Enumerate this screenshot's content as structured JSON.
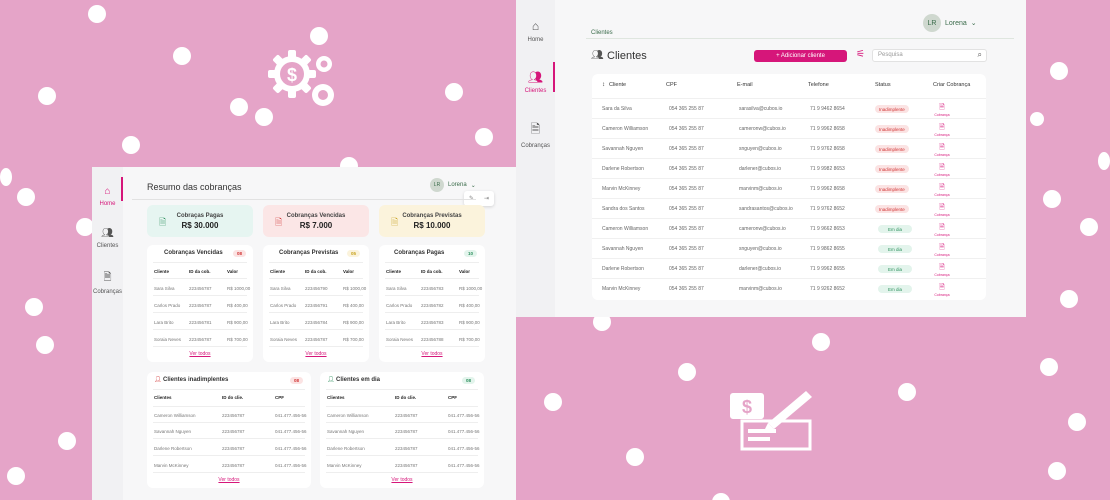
{
  "colors": {
    "accent": "#d6167a",
    "background": "#e5a4c8"
  },
  "dashboard": {
    "nav": [
      {
        "label": "Home",
        "icon": "home-icon",
        "active": true
      },
      {
        "label": "Clientes",
        "icon": "users-icon",
        "active": false
      },
      {
        "label": "Cobranças",
        "icon": "document-icon",
        "active": false
      }
    ],
    "title": "Resumo das cobranças",
    "user": {
      "initials": "LR",
      "name": "Lorena"
    },
    "kpis": [
      {
        "title": "Cobraças Pagas",
        "value": "R$ 30.000"
      },
      {
        "title": "Cobranças Vencidas",
        "value": "R$ 7.000"
      },
      {
        "title": "Cobranças Previstas",
        "value": "R$ 10.000"
      }
    ],
    "tables": [
      {
        "title": "Cobranças Vencidas",
        "count": "08",
        "headers": [
          "Cliente",
          "ID da cob.",
          "Valor"
        ],
        "rows": [
          [
            "Sara Silva",
            "223456787",
            "R$ 1000,00"
          ],
          [
            "Carlos Prado",
            "223456787",
            "R$ 400,00"
          ],
          [
            "Lara Brito",
            "223456781",
            "R$ 900,00"
          ],
          [
            "Soraia Neves",
            "223456787",
            "R$ 700,00"
          ]
        ],
        "link": "Ver todos"
      },
      {
        "title": "Cobranças Previstas",
        "count": "05",
        "headers": [
          "Cliente",
          "ID da cob.",
          "Valor"
        ],
        "rows": [
          [
            "Sara Silva",
            "223456790",
            "R$ 1000,00"
          ],
          [
            "Carlos Prado",
            "223456791",
            "R$ 400,00"
          ],
          [
            "Lara Brito",
            "223456784",
            "R$ 900,00"
          ],
          [
            "Soraia Neves",
            "223456787",
            "R$ 700,00"
          ]
        ],
        "link": "Ver todos"
      },
      {
        "title": "Cobranças Pagas",
        "count": "10",
        "headers": [
          "Cliente",
          "ID da cob.",
          "Valor"
        ],
        "rows": [
          [
            "Sara Silva",
            "223456783",
            "R$ 1000,00"
          ],
          [
            "Carlos Prado",
            "223456782",
            "R$ 400,00"
          ],
          [
            "Lara Brito",
            "223456783",
            "R$ 900,00"
          ],
          [
            "Soraia Neves",
            "223456788",
            "R$ 700,00"
          ]
        ],
        "link": "Ver todos"
      }
    ],
    "client_tables": [
      {
        "title": "Clientes inadimplentes",
        "count": "08",
        "headers": [
          "Clientes",
          "ID do clie.",
          "CPF"
        ],
        "rows": [
          [
            "Cameron Williamson",
            "223456787",
            "041.477.456-56"
          ],
          [
            "Savannah Nguyen",
            "223456787",
            "041.477.456-56"
          ],
          [
            "Darlene Robertson",
            "223456787",
            "041.477.456-56"
          ],
          [
            "Marvin McKinney",
            "223456787",
            "041.477.456-56"
          ]
        ],
        "link": "Ver todos"
      },
      {
        "title": "Clientes em dia",
        "count": "08",
        "headers": [
          "Clientes",
          "ID do clie.",
          "CPF"
        ],
        "rows": [
          [
            "Cameron Williamson",
            "223456787",
            "041.477.456-56"
          ],
          [
            "Savannah Nguyen",
            "223456787",
            "041.477.456-56"
          ],
          [
            "Darlene Robertson",
            "223456787",
            "041.477.456-56"
          ],
          [
            "Marvin McKinney",
            "223456787",
            "041.477.456-56"
          ]
        ],
        "link": "Ver todos"
      }
    ]
  },
  "clients": {
    "nav": [
      {
        "label": "Home",
        "icon": "home-icon",
        "active": false
      },
      {
        "label": "Clientes",
        "icon": "users-icon",
        "active": true
      },
      {
        "label": "Cobranças",
        "icon": "document-icon",
        "active": false
      }
    ],
    "breadcrumb": "Clientes",
    "user": {
      "initials": "LR",
      "name": "Lorena"
    },
    "title": "Clientes",
    "add_button": "+ Adicionar cliente",
    "search_placeholder": "Pesquisa",
    "headers": [
      "Cliente",
      "CPF",
      "E-mail",
      "Telefone",
      "Status",
      "Criar Cobrança"
    ],
    "action_label": "Cobrança",
    "rows": [
      {
        "name": "Sara da Silva",
        "cpf": "054 365 255 87",
        "email": "sarasilva@cubos.io",
        "phone": "71 9 9462 8654",
        "status": "Inadimplente",
        "ok": false
      },
      {
        "name": "Cameron Williamson",
        "cpf": "054 365 255 87",
        "email": "cameronw@cubos.io",
        "phone": "71 9 9962 8658",
        "status": "Inadimplente",
        "ok": false
      },
      {
        "name": "Savannah Nguyen",
        "cpf": "054 365 255 87",
        "email": "snguyen@cubos.io",
        "phone": "71 9 9762 8658",
        "status": "Inadimplente",
        "ok": false
      },
      {
        "name": "Darlene Robertson",
        "cpf": "054 365 255 87",
        "email": "darlener@cubos.io",
        "phone": "71 9 9982 8653",
        "status": "Inadimplente",
        "ok": false
      },
      {
        "name": "Marvin McKinney",
        "cpf": "054 365 255 87",
        "email": "marvinm@cubos.io",
        "phone": "71 9 9962 8658",
        "status": "Inadimplente",
        "ok": false
      },
      {
        "name": "Sandra dos Santos",
        "cpf": "054 365 255 87",
        "email": "sandrasantos@cubos.io",
        "phone": "71 9 9762 8652",
        "status": "Inadimplente",
        "ok": false
      },
      {
        "name": "Cameron Williamson",
        "cpf": "054 365 255 87",
        "email": "cameronw@cubos.io",
        "phone": "71 9 9662 8653",
        "status": "Em dia",
        "ok": true
      },
      {
        "name": "Savannah Nguyen",
        "cpf": "054 365 255 87",
        "email": "snguyen@cubos.io",
        "phone": "71 9 9862 8655",
        "status": "Em dia",
        "ok": true
      },
      {
        "name": "Darlene Robertson",
        "cpf": "054 365 255 87",
        "email": "darlener@cubos.io",
        "phone": "71 9 9962 8655",
        "status": "Em dia",
        "ok": true
      },
      {
        "name": "Marvin McKinney",
        "cpf": "054 365 255 87",
        "email": "marvinm@cubos.io",
        "phone": "71 9 9262 8652",
        "status": "Em dia",
        "ok": true
      }
    ]
  }
}
